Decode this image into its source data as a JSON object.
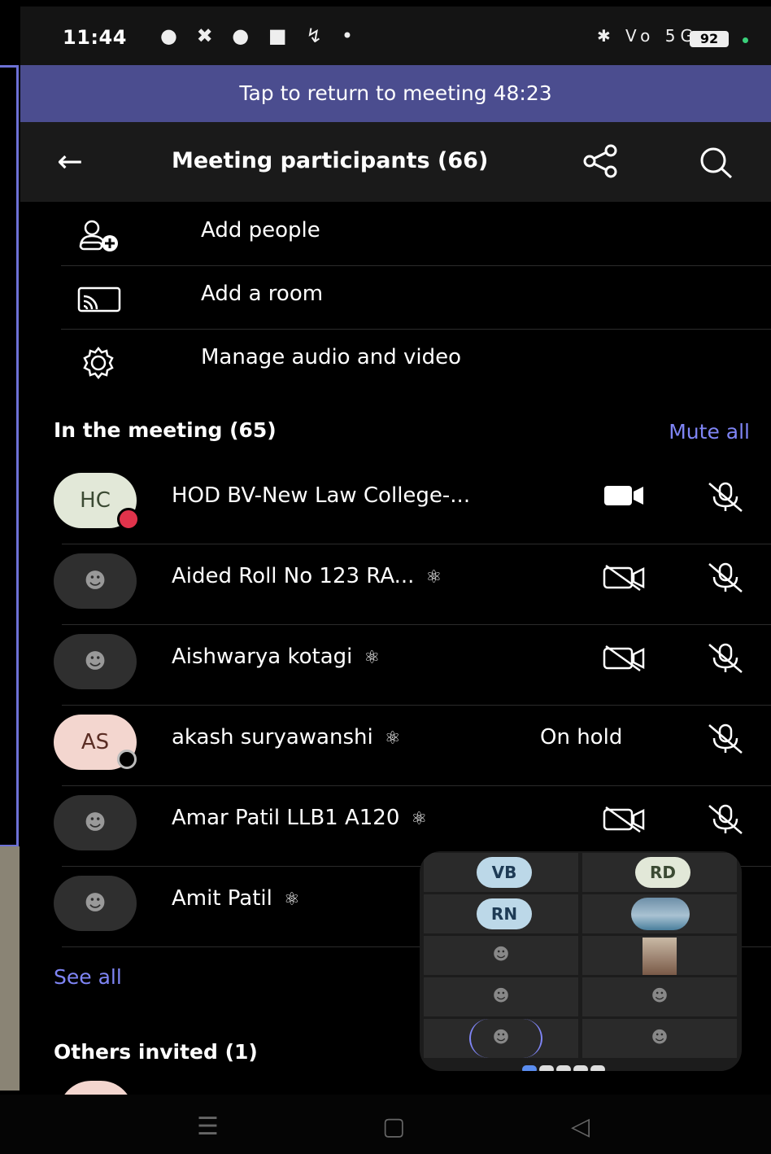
{
  "status_bar": {
    "time": "11:44",
    "left_icons": "● ✖ ● ■ ↯ •",
    "right_icons": "✱ Vo 5G",
    "battery": "92"
  },
  "banner": {
    "text": "Tap to return to meeting 48:23"
  },
  "header": {
    "title": "Meeting participants (66)"
  },
  "menu": [
    {
      "label": "Add people",
      "icon": "add-person-icon"
    },
    {
      "label": "Add a room",
      "icon": "cast-room-icon"
    },
    {
      "label": "Manage audio and video",
      "icon": "gear-icon"
    }
  ],
  "in_meeting": {
    "title": "In the meeting (65)",
    "mute_all": "Mute all"
  },
  "participants": [
    {
      "name": "HOD BV-New Law College-...",
      "initials": "HC",
      "camera": "on",
      "mic": "off"
    },
    {
      "name": "Aided Roll No 123 RA...",
      "initials": "",
      "badge": "guest-icon",
      "camera": "off",
      "mic": "off"
    },
    {
      "name": "Aishwarya kotagi",
      "initials": "",
      "badge": "guest-icon",
      "camera": "off",
      "mic": "off"
    },
    {
      "name": "akash suryawanshi",
      "initials": "AS",
      "badge": "guest-icon",
      "status": "On hold",
      "mic": "off"
    },
    {
      "name": "Amar Patil LLB1 A120",
      "initials": "",
      "badge": "guest-icon",
      "camera": "off",
      "mic": "off"
    },
    {
      "name": "Amit Patil",
      "initials": "",
      "badge": "guest-icon"
    }
  ],
  "see_all": "See all",
  "others_invited": {
    "title": "Others invited (1)"
  },
  "gallery": {
    "tiles": [
      "VB",
      "RD",
      "RN"
    ],
    "page_count": 5,
    "active_page": 1
  },
  "colors": {
    "accent": "#7f85f5",
    "banner": "#4b4d8f",
    "mic_alert": "#e0334b"
  }
}
